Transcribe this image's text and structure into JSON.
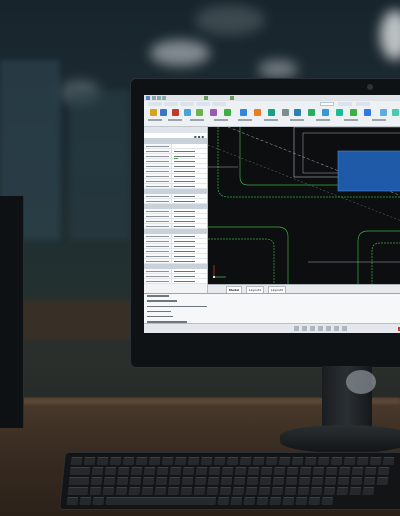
{
  "scene": {
    "description_tags": [
      "office-background",
      "desktop-monitor",
      "keyboard",
      "pc-tower"
    ]
  },
  "app": {
    "name": "CAD drawing application",
    "ribbon_tabs": [
      "",
      "",
      "",
      "",
      "",
      "",
      "",
      ""
    ],
    "window_title": "",
    "properties_panel": {
      "header": "Properties",
      "selection": "No selection",
      "sections": [
        {
          "title": "General",
          "rows": 11
        },
        {
          "title": "3D Visualization",
          "rows": 3
        },
        {
          "title": "Plot style",
          "rows": 4
        },
        {
          "title": "View",
          "rows": 7
        },
        {
          "title": "Misc",
          "rows": 4
        }
      ]
    },
    "layout_tabs": [
      "Model",
      "Layout1",
      "Layout2"
    ],
    "active_layout": "Model",
    "command_line_rows": 8,
    "colors": {
      "canvas": "#0c0e10",
      "road_lines": "#3cb043",
      "viewport_fill": "#1e5aa8",
      "ribbon": "#eef1f4",
      "panel": "#f2f3f4"
    },
    "icons": [
      "ribbon-tool-icon",
      "properties-filter-icon",
      "ucs-icon",
      "close-icon"
    ]
  }
}
